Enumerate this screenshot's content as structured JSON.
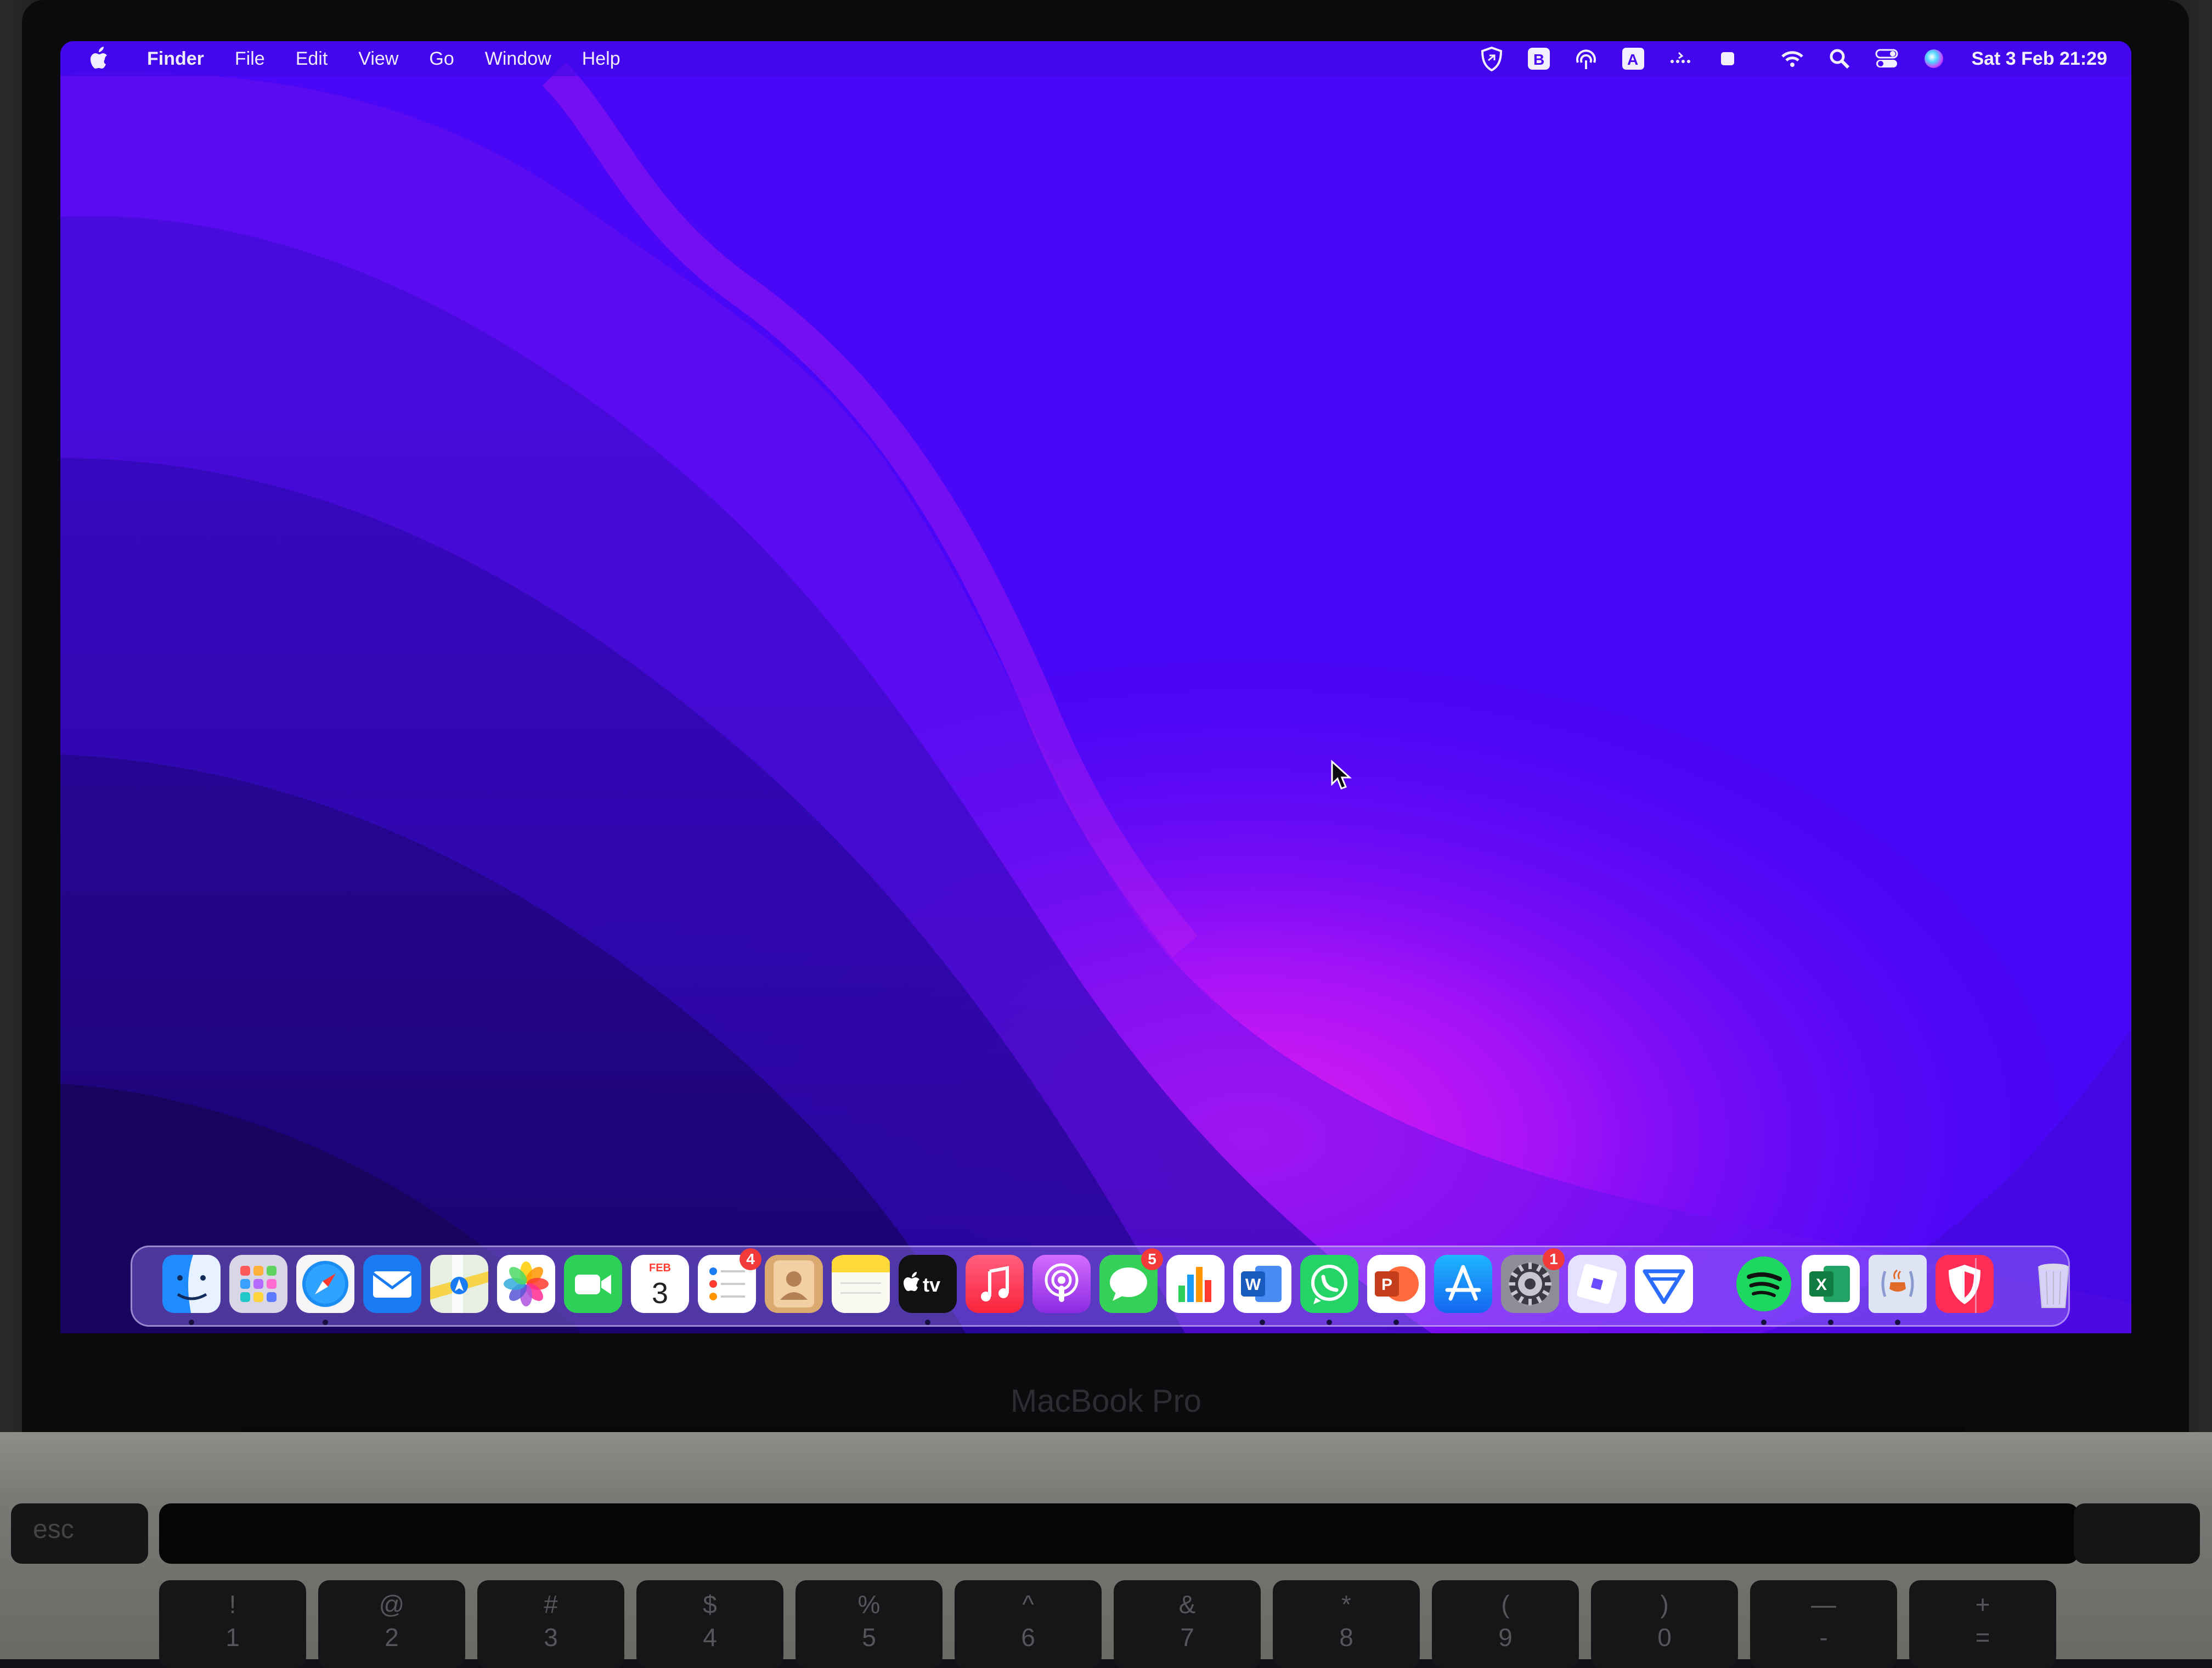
{
  "menubar": {
    "apple_icon": "apple-logo-icon",
    "app_name": "Finder",
    "menus": [
      "File",
      "Edit",
      "View",
      "Go",
      "Window",
      "Help"
    ],
    "status_icons": [
      "vpn-shield-icon",
      "bitwarden-icon",
      "airdrop-icon",
      "input-source-icon",
      "bluetooth-dots-icon",
      "battery-stop-icon",
      "wifi-icon",
      "spotlight-search-icon",
      "control-center-icon",
      "siri-icon"
    ],
    "input_source_letter": "A",
    "clock": "Sat 3 Feb  21:29"
  },
  "dock": {
    "apps": [
      {
        "name": "Finder",
        "icon": "finder-icon",
        "running": true
      },
      {
        "name": "Launchpad",
        "icon": "launchpad-icon",
        "running": false
      },
      {
        "name": "Safari",
        "icon": "safari-icon",
        "running": true
      },
      {
        "name": "Mail",
        "icon": "mail-icon",
        "running": false
      },
      {
        "name": "Maps",
        "icon": "maps-icon",
        "running": false
      },
      {
        "name": "Photos",
        "icon": "photos-icon",
        "running": false
      },
      {
        "name": "FaceTime",
        "icon": "facetime-icon",
        "running": false
      },
      {
        "name": "Calendar",
        "icon": "calendar-icon",
        "running": false,
        "month": "FEB",
        "day": "3"
      },
      {
        "name": "Reminders",
        "icon": "reminders-icon",
        "running": false,
        "badge": "4"
      },
      {
        "name": "Contacts",
        "icon": "contacts-icon",
        "running": false
      },
      {
        "name": "Notes",
        "icon": "notes-icon",
        "running": false
      },
      {
        "name": "TV",
        "icon": "apple-tv-icon",
        "running": true,
        "label": "tv"
      },
      {
        "name": "Music",
        "icon": "music-icon",
        "running": false
      },
      {
        "name": "Podcasts",
        "icon": "podcasts-icon",
        "running": false
      },
      {
        "name": "Messages",
        "icon": "messages-icon",
        "running": false,
        "badge": "5"
      },
      {
        "name": "Numbers",
        "icon": "numbers-icon",
        "running": false
      },
      {
        "name": "Microsoft Word",
        "icon": "word-icon",
        "running": true,
        "letter": "W"
      },
      {
        "name": "WhatsApp",
        "icon": "whatsapp-icon",
        "running": true
      },
      {
        "name": "Microsoft PowerPoint",
        "icon": "powerpoint-icon",
        "running": true,
        "letter": "P"
      },
      {
        "name": "App Store",
        "icon": "app-store-icon",
        "running": false
      },
      {
        "name": "System Settings",
        "icon": "system-settings-icon",
        "running": false,
        "badge": "1"
      },
      {
        "name": "Roblox",
        "icon": "roblox-icon",
        "running": false
      },
      {
        "name": "Surfshark",
        "icon": "surfshark-icon",
        "running": false
      },
      {
        "name": "Spotify",
        "icon": "spotify-icon",
        "running": true
      },
      {
        "name": "Microsoft Excel",
        "icon": "excel-icon",
        "running": true,
        "letter": "X"
      },
      {
        "name": "Java",
        "icon": "java-icon",
        "running": true
      },
      {
        "name": "Security Shield",
        "icon": "security-shield-icon",
        "running": false
      },
      {
        "name": "Trash",
        "icon": "trash-icon",
        "running": false
      }
    ]
  },
  "hardware": {
    "bezel_label": "MacBook Pro",
    "esc_label": "esc",
    "number_keys": [
      {
        "top": "!",
        "bottom": "1"
      },
      {
        "top": "@",
        "bottom": "2"
      },
      {
        "top": "#",
        "bottom": "3"
      },
      {
        "top": "$",
        "bottom": "4"
      },
      {
        "top": "%",
        "bottom": "5"
      },
      {
        "top": "^",
        "bottom": "6"
      },
      {
        "top": "&",
        "bottom": "7"
      },
      {
        "top": "*",
        "bottom": "8"
      },
      {
        "top": "(",
        "bottom": "9"
      },
      {
        "top": ")",
        "bottom": "0"
      },
      {
        "top": "—",
        "bottom": "-"
      },
      {
        "top": "+",
        "bottom": "="
      }
    ]
  },
  "colors": {
    "wallpaper_base": "#4b06f5",
    "wallpaper_magenta": "#d21ef0",
    "wallpaper_deep": "#2a058f",
    "menubar_text": "#f2efff",
    "badge_red": "#f23a3a"
  }
}
